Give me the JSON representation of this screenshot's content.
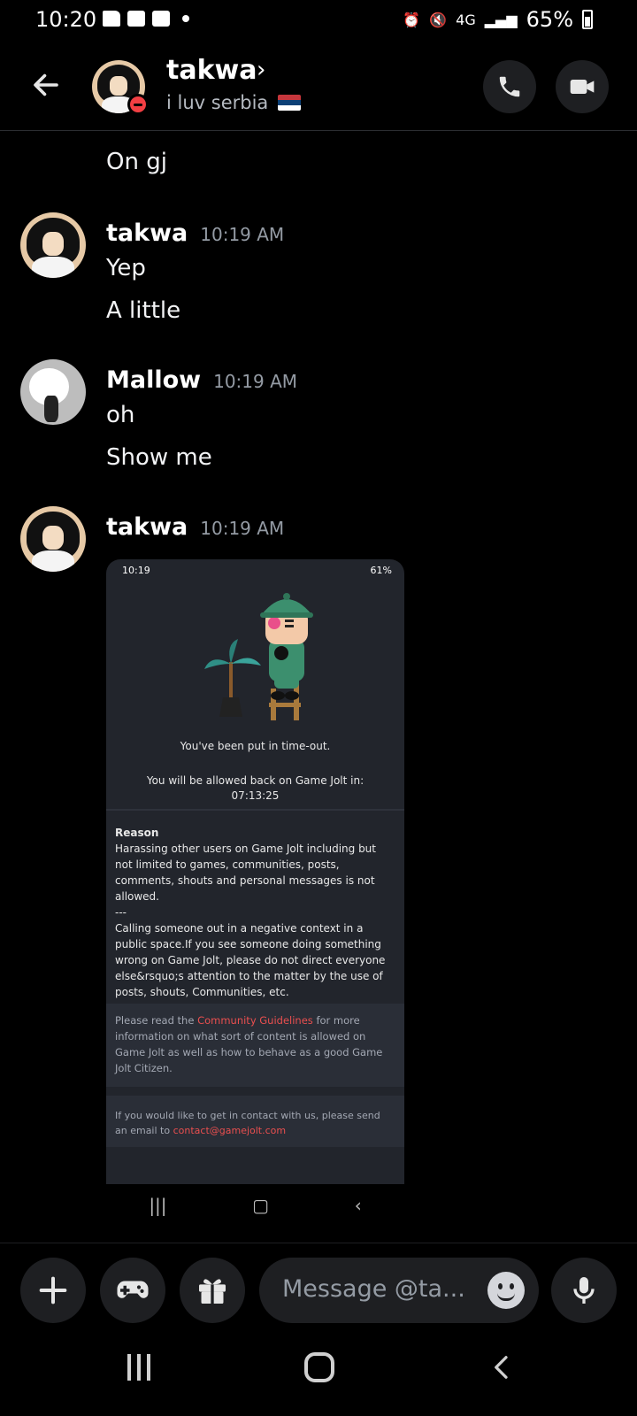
{
  "statusbar": {
    "time": "10:20",
    "network": "4G",
    "battery": "65%"
  },
  "header": {
    "name": "takwa",
    "status": "i luv serbia",
    "chevron": "›"
  },
  "messages": [
    {
      "text": "On gj"
    },
    {
      "author": "takwa",
      "time": "10:19 AM",
      "lines": [
        "Yep",
        "A little"
      ]
    },
    {
      "author": "Mallow",
      "time": "10:19 AM",
      "lines": [
        "oh",
        "Show me"
      ]
    },
    {
      "author": "takwa",
      "time": "10:19 AM"
    }
  ],
  "embed": {
    "status_time": "10:19",
    "status_battery": "61%",
    "timeout_text": "You've been put in time-out.",
    "allowed_text": "You will be allowed back on Game Jolt in:",
    "countdown": "07:13:25",
    "reason_title": "Reason",
    "reason_body_1": "Harassing other users on Game Jolt including but not limited to games, communities, posts, comments, shouts and personal messages is not allowed.",
    "reason_sep": "---",
    "reason_body_2": "Calling someone out in a negative context in a public space.If you see someone doing something wrong on Game Jolt, please do not direct everyone else&rsquo;s attention to the matter by the use of posts, shouts, Communities, etc.",
    "guide_prefix": "Please read the ",
    "guide_link": "Community Guidelines",
    "guide_suffix": " for more information on what sort of content is allowed on Game Jolt as well as how to behave as a good Game Jolt Citizen.",
    "contact_prefix": "If you would like to get in contact with us, please send an email to ",
    "contact_link": "contact@gamejolt.com"
  },
  "composer": {
    "placeholder": "Message @ta..."
  },
  "colors": {
    "background": "#000000",
    "input_bg": "#1e1f22",
    "dnd_red": "#f23f43",
    "link_red": "#ea4f4f"
  },
  "icons": [
    "back-arrow-icon",
    "call-icon",
    "video-icon",
    "plus-icon",
    "gamepad-icon",
    "gift-icon",
    "emoji-icon",
    "mic-icon"
  ]
}
